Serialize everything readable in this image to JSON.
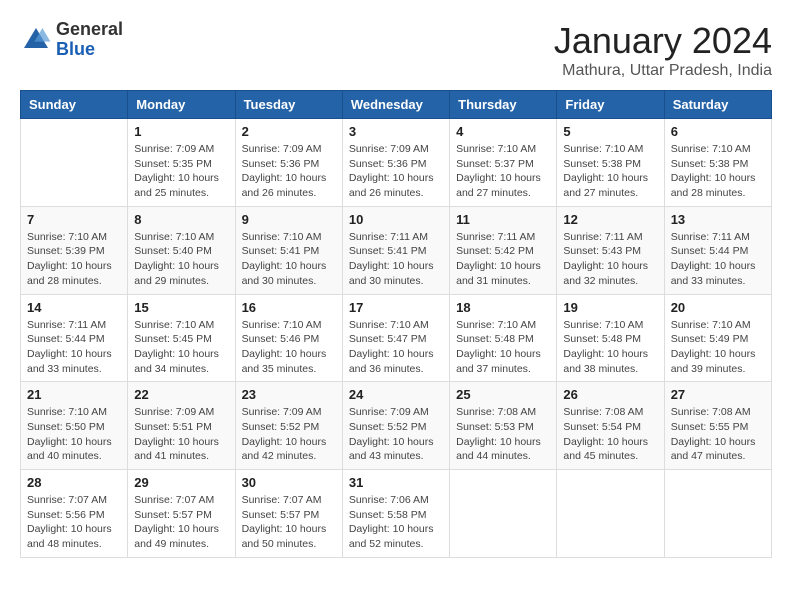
{
  "header": {
    "logo_general": "General",
    "logo_blue": "Blue",
    "month_title": "January 2024",
    "location": "Mathura, Uttar Pradesh, India"
  },
  "weekdays": [
    "Sunday",
    "Monday",
    "Tuesday",
    "Wednesday",
    "Thursday",
    "Friday",
    "Saturday"
  ],
  "weeks": [
    [
      {
        "day": "",
        "info": ""
      },
      {
        "day": "1",
        "info": "Sunrise: 7:09 AM\nSunset: 5:35 PM\nDaylight: 10 hours\nand 25 minutes."
      },
      {
        "day": "2",
        "info": "Sunrise: 7:09 AM\nSunset: 5:36 PM\nDaylight: 10 hours\nand 26 minutes."
      },
      {
        "day": "3",
        "info": "Sunrise: 7:09 AM\nSunset: 5:36 PM\nDaylight: 10 hours\nand 26 minutes."
      },
      {
        "day": "4",
        "info": "Sunrise: 7:10 AM\nSunset: 5:37 PM\nDaylight: 10 hours\nand 27 minutes."
      },
      {
        "day": "5",
        "info": "Sunrise: 7:10 AM\nSunset: 5:38 PM\nDaylight: 10 hours\nand 27 minutes."
      },
      {
        "day": "6",
        "info": "Sunrise: 7:10 AM\nSunset: 5:38 PM\nDaylight: 10 hours\nand 28 minutes."
      }
    ],
    [
      {
        "day": "7",
        "info": "Sunrise: 7:10 AM\nSunset: 5:39 PM\nDaylight: 10 hours\nand 28 minutes."
      },
      {
        "day": "8",
        "info": "Sunrise: 7:10 AM\nSunset: 5:40 PM\nDaylight: 10 hours\nand 29 minutes."
      },
      {
        "day": "9",
        "info": "Sunrise: 7:10 AM\nSunset: 5:41 PM\nDaylight: 10 hours\nand 30 minutes."
      },
      {
        "day": "10",
        "info": "Sunrise: 7:11 AM\nSunset: 5:41 PM\nDaylight: 10 hours\nand 30 minutes."
      },
      {
        "day": "11",
        "info": "Sunrise: 7:11 AM\nSunset: 5:42 PM\nDaylight: 10 hours\nand 31 minutes."
      },
      {
        "day": "12",
        "info": "Sunrise: 7:11 AM\nSunset: 5:43 PM\nDaylight: 10 hours\nand 32 minutes."
      },
      {
        "day": "13",
        "info": "Sunrise: 7:11 AM\nSunset: 5:44 PM\nDaylight: 10 hours\nand 33 minutes."
      }
    ],
    [
      {
        "day": "14",
        "info": "Sunrise: 7:11 AM\nSunset: 5:44 PM\nDaylight: 10 hours\nand 33 minutes."
      },
      {
        "day": "15",
        "info": "Sunrise: 7:10 AM\nSunset: 5:45 PM\nDaylight: 10 hours\nand 34 minutes."
      },
      {
        "day": "16",
        "info": "Sunrise: 7:10 AM\nSunset: 5:46 PM\nDaylight: 10 hours\nand 35 minutes."
      },
      {
        "day": "17",
        "info": "Sunrise: 7:10 AM\nSunset: 5:47 PM\nDaylight: 10 hours\nand 36 minutes."
      },
      {
        "day": "18",
        "info": "Sunrise: 7:10 AM\nSunset: 5:48 PM\nDaylight: 10 hours\nand 37 minutes."
      },
      {
        "day": "19",
        "info": "Sunrise: 7:10 AM\nSunset: 5:48 PM\nDaylight: 10 hours\nand 38 minutes."
      },
      {
        "day": "20",
        "info": "Sunrise: 7:10 AM\nSunset: 5:49 PM\nDaylight: 10 hours\nand 39 minutes."
      }
    ],
    [
      {
        "day": "21",
        "info": "Sunrise: 7:10 AM\nSunset: 5:50 PM\nDaylight: 10 hours\nand 40 minutes."
      },
      {
        "day": "22",
        "info": "Sunrise: 7:09 AM\nSunset: 5:51 PM\nDaylight: 10 hours\nand 41 minutes."
      },
      {
        "day": "23",
        "info": "Sunrise: 7:09 AM\nSunset: 5:52 PM\nDaylight: 10 hours\nand 42 minutes."
      },
      {
        "day": "24",
        "info": "Sunrise: 7:09 AM\nSunset: 5:52 PM\nDaylight: 10 hours\nand 43 minutes."
      },
      {
        "day": "25",
        "info": "Sunrise: 7:08 AM\nSunset: 5:53 PM\nDaylight: 10 hours\nand 44 minutes."
      },
      {
        "day": "26",
        "info": "Sunrise: 7:08 AM\nSunset: 5:54 PM\nDaylight: 10 hours\nand 45 minutes."
      },
      {
        "day": "27",
        "info": "Sunrise: 7:08 AM\nSunset: 5:55 PM\nDaylight: 10 hours\nand 47 minutes."
      }
    ],
    [
      {
        "day": "28",
        "info": "Sunrise: 7:07 AM\nSunset: 5:56 PM\nDaylight: 10 hours\nand 48 minutes."
      },
      {
        "day": "29",
        "info": "Sunrise: 7:07 AM\nSunset: 5:57 PM\nDaylight: 10 hours\nand 49 minutes."
      },
      {
        "day": "30",
        "info": "Sunrise: 7:07 AM\nSunset: 5:57 PM\nDaylight: 10 hours\nand 50 minutes."
      },
      {
        "day": "31",
        "info": "Sunrise: 7:06 AM\nSunset: 5:58 PM\nDaylight: 10 hours\nand 52 minutes."
      },
      {
        "day": "",
        "info": ""
      },
      {
        "day": "",
        "info": ""
      },
      {
        "day": "",
        "info": ""
      }
    ]
  ]
}
